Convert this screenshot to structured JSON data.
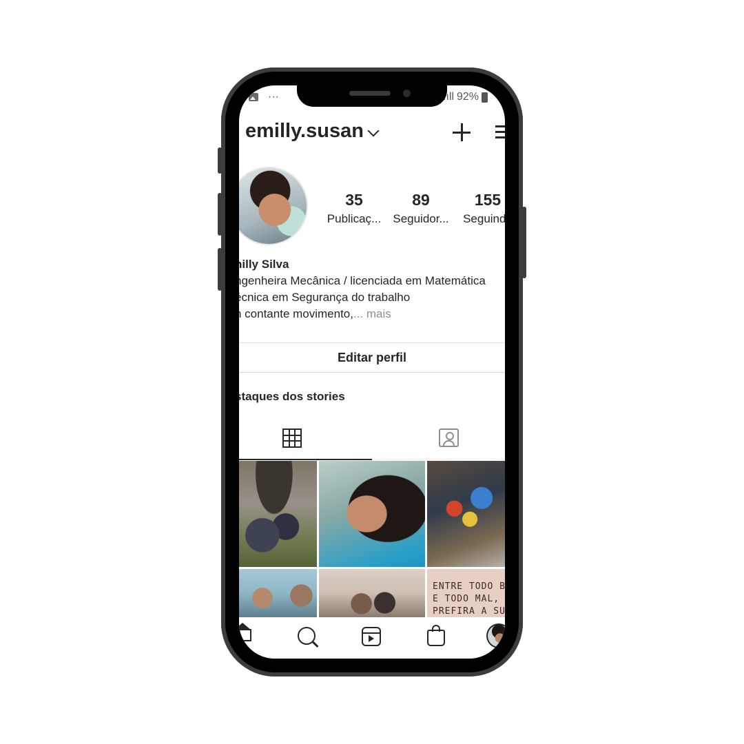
{
  "status_bar": {
    "left_dots": "···",
    "signal": ".ıll",
    "battery_percent": "92%"
  },
  "header": {
    "username": "emilly.susan"
  },
  "profile": {
    "stats": [
      {
        "value": "35",
        "label": "Publicaç..."
      },
      {
        "value": "89",
        "label": "Seguidor..."
      },
      {
        "value": "155",
        "label": "Seguindo"
      }
    ],
    "name": "nilly Silva",
    "bio_lines": [
      "ngenheira Mecânica / licenciada em Matemática",
      "écnica em Segurança do trabalho",
      "n contante movimento,"
    ],
    "more_label": "... mais"
  },
  "actions": {
    "edit_profile": "Editar perfil"
  },
  "highlights": {
    "title": "staques dos stories"
  },
  "tabs": [
    "grid-icon",
    "tagged-icon"
  ],
  "grid_photo_6_text": [
    "ENTRE TODO BEM",
    "E TODO MAL,",
    "PREFIRA A SUA"
  ],
  "bottom_nav": [
    "home-icon",
    "search-icon",
    "reels-icon",
    "shop-icon",
    "profile-avatar"
  ]
}
